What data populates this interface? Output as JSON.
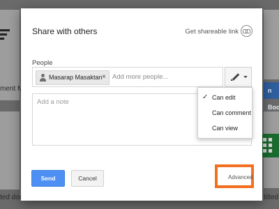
{
  "background": {
    "left_doc_label": "ment Mo",
    "left_bottom_label": "ted docu",
    "right_blue_label": "n Book",
    "right_bottom_label": "titled s"
  },
  "dialog": {
    "title": "Share with others",
    "shareable_link_label": "Get shareable link",
    "people_label": "People",
    "chip_name": "Masarap Masaktan",
    "chip_remove": "×",
    "add_more_placeholder": "Add more people...",
    "note_placeholder": "Add a note",
    "send_label": "Send",
    "cancel_label": "Cancel",
    "advanced_label": "Advanced"
  },
  "permissions": {
    "options": [
      {
        "label": "Can edit",
        "selected": true
      },
      {
        "label": "Can comment",
        "selected": false
      },
      {
        "label": "Can view",
        "selected": false
      }
    ],
    "check_glyph": "✓"
  },
  "colors": {
    "send_button": "#4d8ff3",
    "highlight": "#f36f21"
  }
}
